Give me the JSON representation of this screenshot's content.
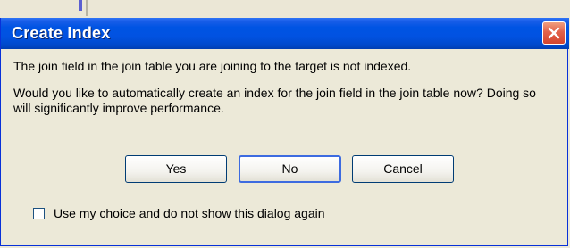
{
  "dialog": {
    "title": "Create Index",
    "message_primary": "The join field in the join table you are joining to the target is not indexed.",
    "message_secondary": "Would you like to automatically create an index for the join field in the join table now? Doing so will significantly improve performance.",
    "buttons": {
      "yes": "Yes",
      "no": "No",
      "cancel": "Cancel"
    },
    "checkbox": {
      "label": "Use my choice and do not show this dialog again",
      "checked": false
    },
    "close_icon": "close-icon"
  },
  "colors": {
    "titlebar": "#0054e3",
    "close_button": "#e2614a",
    "dialog_background": "#ece9d8"
  }
}
